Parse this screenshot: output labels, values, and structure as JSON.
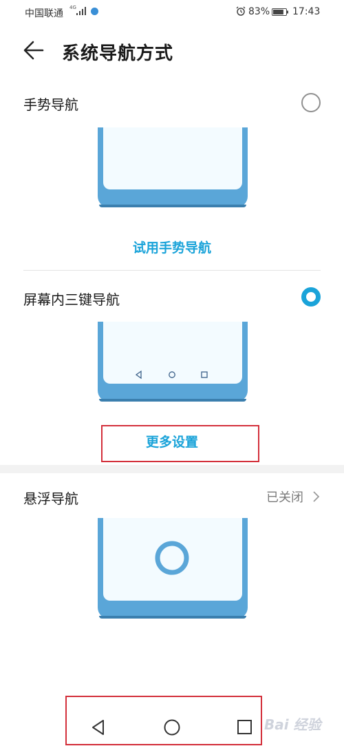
{
  "status_bar": {
    "carrier": "中国联通",
    "network_badge": "4G",
    "battery_percent": "83%",
    "time": "17:43",
    "battery_level": 0.83
  },
  "header": {
    "title": "系统导航方式",
    "back_icon": "arrow-left-icon"
  },
  "options": {
    "gesture": {
      "label": "手势导航",
      "selected": false,
      "try_label": "试用手势导航"
    },
    "three_key": {
      "label": "屏幕内三键导航",
      "selected": true,
      "more_settings_label": "更多设置"
    },
    "floating": {
      "label": "悬浮导航",
      "status": "已关闭"
    }
  },
  "nav_bar": {
    "back_icon": "triangle-back-icon",
    "home_icon": "circle-home-icon",
    "recents_icon": "square-recents-icon"
  },
  "watermark": {
    "text": "Bai 经验"
  },
  "colors": {
    "accent": "#1aa3d9",
    "phone_frame": "#5aa6d8",
    "highlight_box": "#d32f3a"
  }
}
